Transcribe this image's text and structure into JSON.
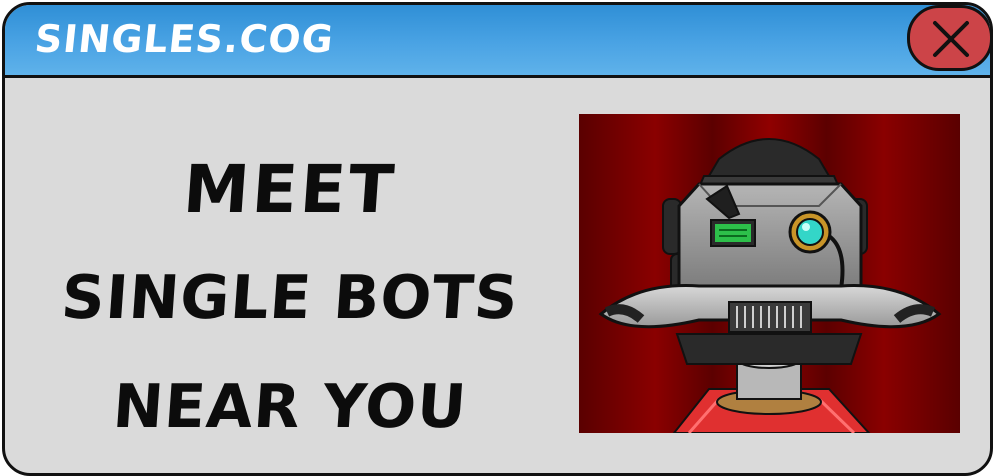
{
  "window": {
    "title": "SINGLES.COG",
    "close_icon": "close-icon"
  },
  "ad": {
    "lines": [
      "MEET",
      "SINGLE BOTS",
      "NEAR YOU"
    ],
    "image": "robot-cog-portrait"
  },
  "colors": {
    "titlebar": "#3a9be0",
    "body": "#dadada",
    "close_button": "#cc4448",
    "picture_background": "#7a0000"
  }
}
